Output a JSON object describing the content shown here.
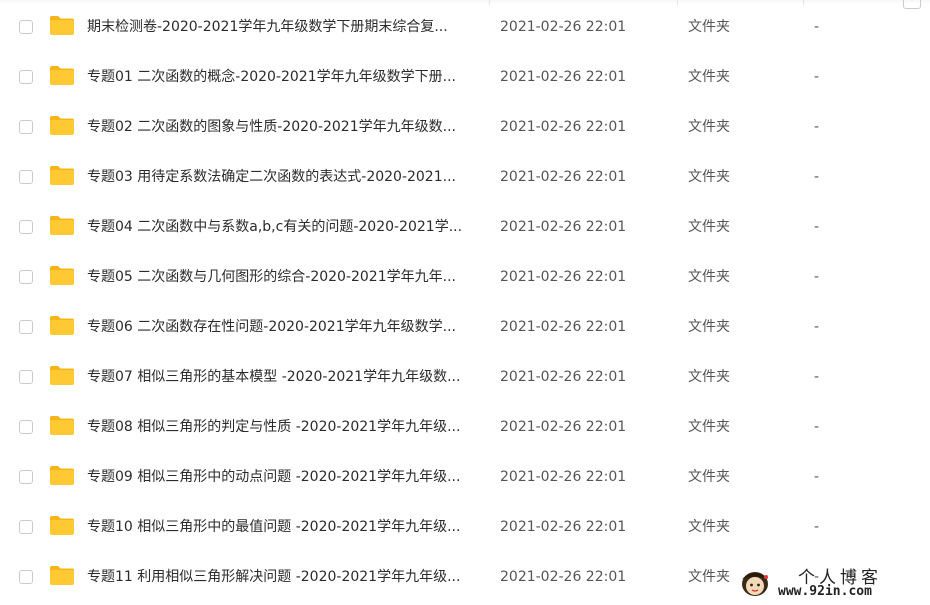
{
  "files": [
    {
      "name": "期末检测卷-2020-2021学年九年级数学下册期末综合复...",
      "date": "2021-02-26 22:01",
      "type": "文件夹",
      "size": "-"
    },
    {
      "name": "专题01 二次函数的概念-2020-2021学年九年级数学下册...",
      "date": "2021-02-26 22:01",
      "type": "文件夹",
      "size": "-"
    },
    {
      "name": "专题02 二次函数的图象与性质-2020-2021学年九年级数...",
      "date": "2021-02-26 22:01",
      "type": "文件夹",
      "size": "-"
    },
    {
      "name": "专题03 用待定系数法确定二次函数的表达式-2020-2021...",
      "date": "2021-02-26 22:01",
      "type": "文件夹",
      "size": "-"
    },
    {
      "name": "专题04 二次函数中与系数a,b,c有关的问题-2020-2021学...",
      "date": "2021-02-26 22:01",
      "type": "文件夹",
      "size": "-"
    },
    {
      "name": "专题05 二次函数与几何图形的综合-2020-2021学年九年...",
      "date": "2021-02-26 22:01",
      "type": "文件夹",
      "size": "-"
    },
    {
      "name": "专题06 二次函数存在性问题-2020-2021学年九年级数学...",
      "date": "2021-02-26 22:01",
      "type": "文件夹",
      "size": "-"
    },
    {
      "name": "专题07 相似三角形的基本模型 -2020-2021学年九年级数...",
      "date": "2021-02-26 22:01",
      "type": "文件夹",
      "size": "-"
    },
    {
      "name": "专题08 相似三角形的判定与性质 -2020-2021学年九年级...",
      "date": "2021-02-26 22:01",
      "type": "文件夹",
      "size": "-"
    },
    {
      "name": "专题09 相似三角形中的动点问题 -2020-2021学年九年级...",
      "date": "2021-02-26 22:01",
      "type": "文件夹",
      "size": "-"
    },
    {
      "name": "专题10 相似三角形中的最值问题 -2020-2021学年九年级...",
      "date": "2021-02-26 22:01",
      "type": "文件夹",
      "size": "-"
    },
    {
      "name": "专题11 利用相似三角形解决问题 -2020-2021学年九年级...",
      "date": "2021-02-26 22:01",
      "type": "文件夹",
      "size": "-"
    }
  ],
  "colors": {
    "folder": "#FFC933",
    "folder_tab": "#F5B417"
  },
  "icons": {
    "folder": "folder-icon",
    "checkbox": "checkbox"
  },
  "watermark": {
    "title": "个人博客",
    "url": "www.92in.com"
  }
}
